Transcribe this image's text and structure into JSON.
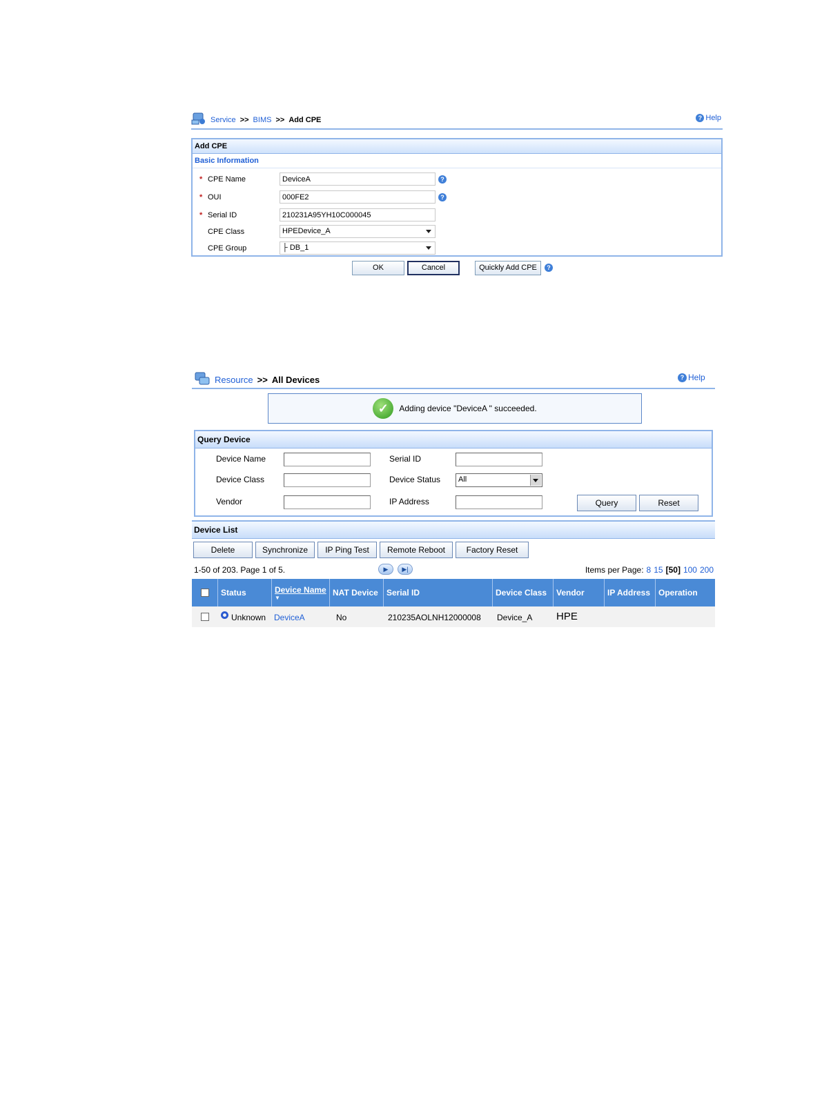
{
  "panel1": {
    "breadcrumb": {
      "item1": "Service",
      "sep": ">>",
      "item2": "BIMS",
      "current": "Add CPE"
    },
    "help": "Help",
    "box_title": "Add CPE",
    "section_title": "Basic Information",
    "fields": [
      {
        "label": "CPE Name",
        "value": "DeviceA",
        "required": true
      },
      {
        "label": "OUI",
        "value": "000FE2",
        "required": true
      },
      {
        "label": "Serial ID",
        "value": "210231A95YH10C000045",
        "required": true
      },
      {
        "label": "CPE Class",
        "value": "HPEDevice_A"
      },
      {
        "label": "CPE Group",
        "value": "├ DB_1"
      }
    ],
    "required_mark": "*",
    "buttons": {
      "ok": "OK",
      "cancel": "Cancel",
      "quick_add": "Quickly Add CPE"
    }
  },
  "panel2": {
    "breadcrumb": {
      "item1": "Resource",
      "sep": ">>",
      "current": "All Devices"
    },
    "help": "Help",
    "message": "Adding device \"DeviceA \" succeeded.",
    "query": {
      "title": "Query Device",
      "labels": {
        "device_name": "Device Name",
        "serial_id": "Serial ID",
        "device_class": "Device Class",
        "device_status": "Device Status",
        "vendor": "Vendor",
        "ip_address": "IP Address"
      },
      "device_status_value": "All",
      "query_btn": "Query",
      "reset_btn": "Reset"
    },
    "list": {
      "title": "Device List",
      "actions": [
        "Delete",
        "Synchronize",
        "IP Ping Test",
        "Remote Reboot",
        "Factory Reset"
      ],
      "pagination": "1-50 of 203. Page 1 of 5.",
      "items_per_page_label": "Items per Page:",
      "page_sizes": {
        "s8": "8",
        "s15": "15",
        "s50": "[50]",
        "s100": "100",
        "s200": "200"
      },
      "columns": {
        "status": "Status",
        "device_name": "Device Name",
        "nat_device": "NAT Device",
        "serial_id": "Serial ID",
        "device_class": "Device Class",
        "vendor": "Vendor",
        "ip_address": "IP Address",
        "operation": "Operation"
      },
      "rows": [
        {
          "status": "Unknown",
          "device_name": "DeviceA",
          "nat_device": "No",
          "serial_id": "210235AOLNH12000008",
          "device_class": "Device_A",
          "vendor": "HPE",
          "ip_address": "",
          "operation": ""
        }
      ]
    }
  },
  "colors": {
    "header_blue": "#4a8ad6",
    "link": "#1f5fd6",
    "border_blue": "#8fb4e8"
  }
}
